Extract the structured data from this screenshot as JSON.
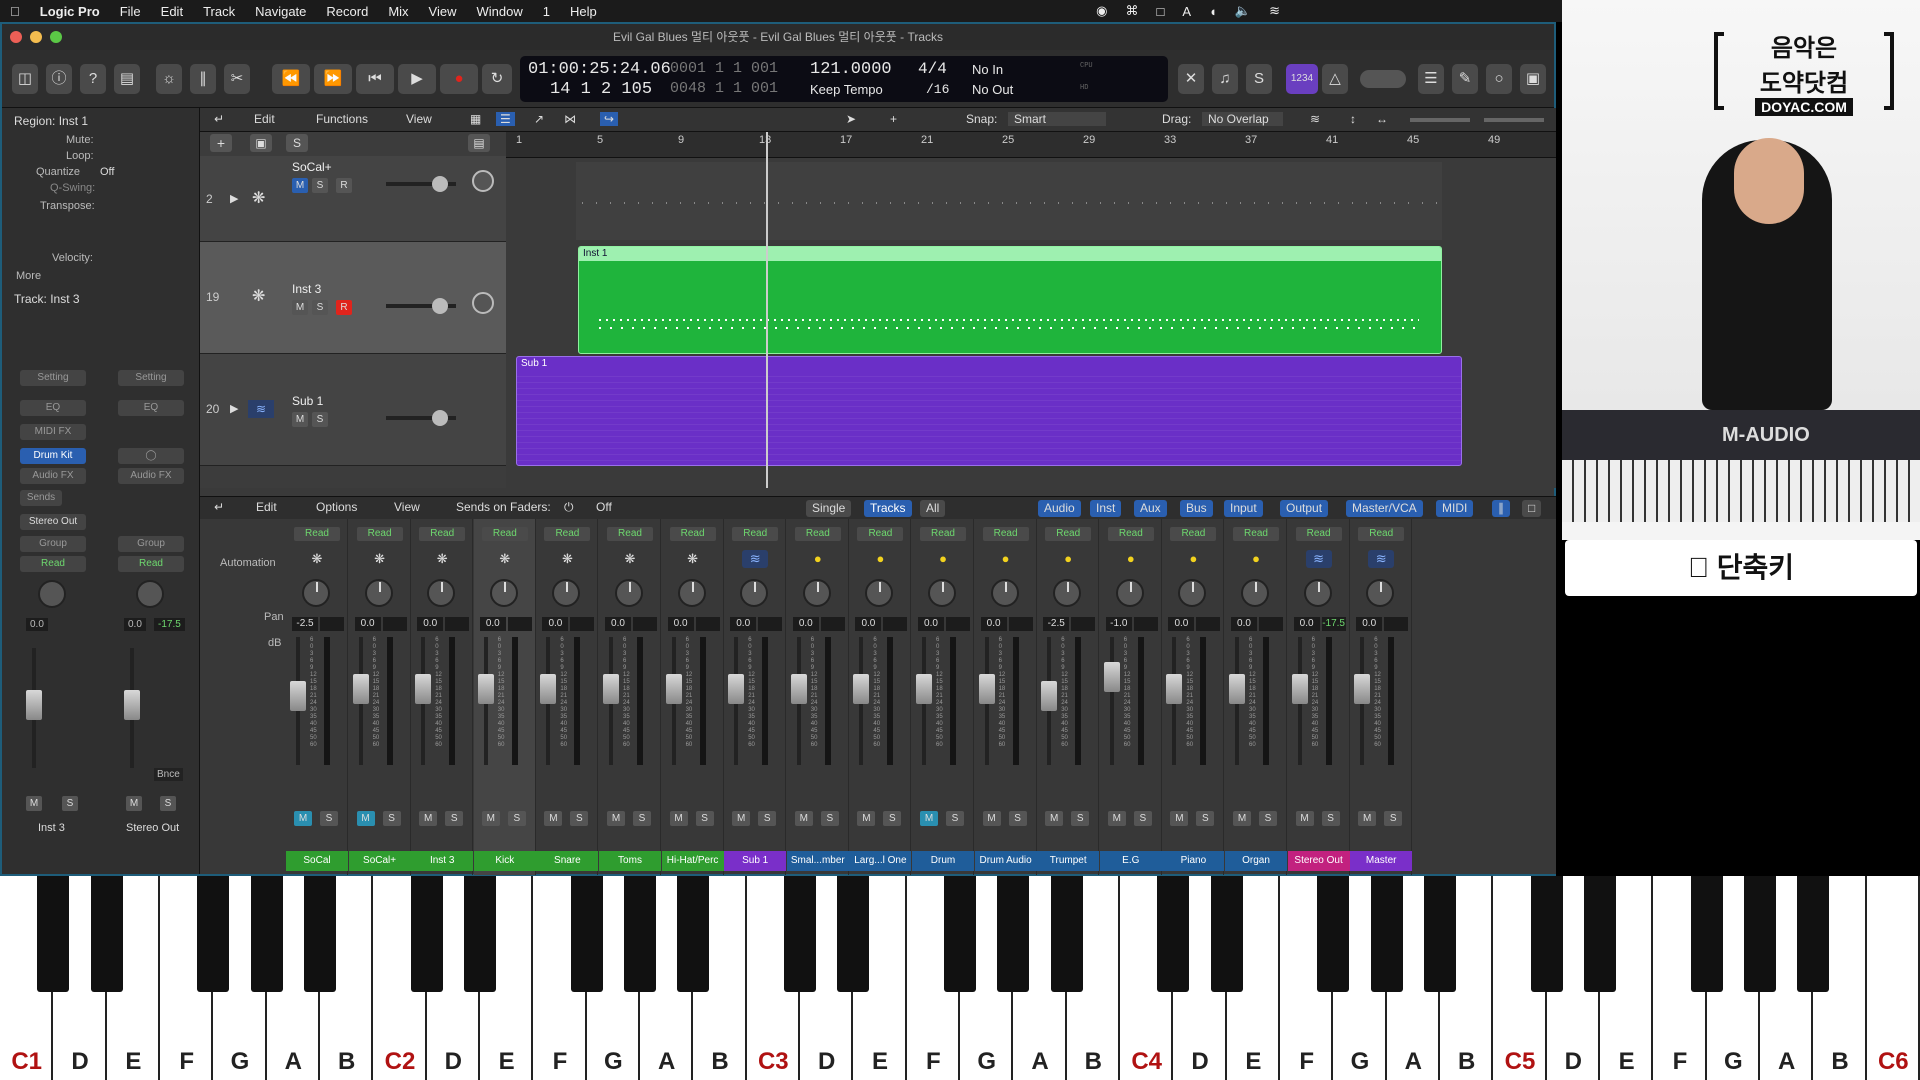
{
  "menubar": {
    "app": "Logic Pro",
    "items": [
      "File",
      "Edit",
      "Track",
      "Navigate",
      "Record",
      "Mix",
      "View",
      "Window",
      "1",
      "Help"
    ]
  },
  "window_title": "Evil Gal Blues 멀티 아웃풋 - Evil Gal Blues 멀티 아웃풋 - Tracks",
  "lcd": {
    "position_time": "01:00:25:24.06",
    "bars1": "0001  1  1  001",
    "tempo": "121.0000",
    "signature": "4/4",
    "in": "No In",
    "position_bars": "14  1  2  105",
    "bars2": "0048  1  1  001",
    "tempo_mode": "Keep Tempo",
    "division": "/16",
    "out": "No Out",
    "cpu": "CPU",
    "hd": "HD"
  },
  "inspector": {
    "region_header": "Region: Inst 1",
    "mute": "Mute:",
    "loop": "Loop:",
    "quantize_label": "Quantize",
    "quantize_value": "Off",
    "qswing": "Q-Swing:",
    "transpose": "Transpose:",
    "velocity": "Velocity:",
    "more": "More",
    "track_header": "Track:  Inst 3",
    "setting": "Setting",
    "eq": "EQ",
    "midi_fx": "MIDI FX",
    "drum_kit": "Drum Kit",
    "audio_fx": "Audio FX",
    "sends": "Sends",
    "stereo_out": "Stereo Out",
    "group": "Group",
    "read": "Read",
    "db_left": "0.0",
    "db_right": "0.0",
    "db_right2": "-17.5",
    "bnce": "Bnce",
    "strip1_name": "Inst 3",
    "strip2_name": "Stereo Out"
  },
  "tm_toolbar": {
    "edit": "Edit",
    "functions": "Functions",
    "view": "View",
    "snap_label": "Snap:",
    "snap_value": "Smart",
    "drag_label": "Drag:",
    "drag_value": "No Overlap"
  },
  "ruler": [
    "1",
    "5",
    "9",
    "13",
    "17",
    "21",
    "25",
    "29",
    "33",
    "37",
    "41",
    "45",
    "49"
  ],
  "tracks": [
    {
      "num": "2",
      "name": "SoCal+"
    },
    {
      "num": "19",
      "name": "Inst 3"
    },
    {
      "num": "20",
      "name": "Sub 1"
    }
  ],
  "regions": {
    "inst": "Inst 1",
    "sub": "Sub 1"
  },
  "mixer_toolbar": {
    "edit": "Edit",
    "options": "Options",
    "view": "View",
    "sends_label": "Sends on Faders:",
    "sends_value": "Off",
    "single": "Single",
    "tracks": "Tracks",
    "all": "All",
    "filters": [
      "Audio",
      "Inst",
      "Aux",
      "Bus",
      "Input",
      "Output",
      "Master/VCA",
      "MIDI"
    ]
  },
  "mixer_labels": {
    "automation": "Automation",
    "pan": "Pan",
    "db": "dB"
  },
  "channels": [
    {
      "name": "SoCal",
      "db": "-2.5",
      "level": 0.55,
      "color": "#2f9d2f",
      "icon": "drum-kit-icon",
      "mute_on": true
    },
    {
      "name": "SoCal+",
      "db": "0.0",
      "level": 0.62,
      "color": "#2f9d2f",
      "icon": "drum-kit-icon",
      "mute_on": true
    },
    {
      "name": "Inst 3",
      "db": "0.0",
      "level": 0.62,
      "color": "#2f9d2f",
      "icon": "drum-kit-icon",
      "mute_on": false
    },
    {
      "name": "Kick",
      "db": "0.0",
      "level": 0.62,
      "color": "#2f9d2f",
      "icon": "drum-kit-icon",
      "mute_on": false
    },
    {
      "name": "Snare",
      "db": "0.0",
      "level": 0.62,
      "color": "#2f9d2f",
      "icon": "drum-kit-icon",
      "mute_on": false
    },
    {
      "name": "Toms",
      "db": "0.0",
      "level": 0.62,
      "color": "#2f9d2f",
      "icon": "drum-kit-icon",
      "mute_on": false
    },
    {
      "name": "Hi-Hat/Perc",
      "db": "0.0",
      "level": 0.62,
      "color": "#2f9d2f",
      "icon": "drum-kit-icon",
      "mute_on": false
    },
    {
      "name": "Sub 1",
      "db": "0.0",
      "level": 0.62,
      "color": "#7a2fc9",
      "icon": "waveform-icon",
      "mute_on": false
    },
    {
      "name": "Smal...mber",
      "db": "0.0",
      "level": 0.62,
      "color": "#1f5d9a",
      "icon": "knob-icon",
      "mute_on": false
    },
    {
      "name": "Larg...l One",
      "db": "0.0",
      "level": 0.62,
      "color": "#1f5d9a",
      "icon": "knob-icon",
      "mute_on": false
    },
    {
      "name": "Drum",
      "db": "0.0",
      "level": 0.62,
      "color": "#1f5d9a",
      "icon": "knob-icon",
      "mute_on": true
    },
    {
      "name": "Drum Audio",
      "db": "0.0",
      "level": 0.62,
      "color": "#1f5d9a",
      "icon": "knob-icon",
      "mute_on": false
    },
    {
      "name": "Trumpet",
      "db": "-2.5",
      "level": 0.55,
      "color": "#1f5d9a",
      "icon": "knob-icon",
      "mute_on": false
    },
    {
      "name": "E.G",
      "db": "-1.0",
      "level": 0.74,
      "color": "#1f5d9a",
      "icon": "knob-icon",
      "mute_on": false
    },
    {
      "name": "Piano",
      "db": "0.0",
      "level": 0.62,
      "color": "#1f5d9a",
      "icon": "knob-icon",
      "mute_on": false
    },
    {
      "name": "Organ",
      "db": "0.0",
      "level": 0.62,
      "color": "#1f5d9a",
      "icon": "knob-icon",
      "mute_on": false
    },
    {
      "name": "Stereo Out",
      "db": "0.0",
      "db2": "-17.5",
      "level": 0.62,
      "color": "#c2217f",
      "icon": "waveform-icon",
      "mute_on": false
    },
    {
      "name": "Master",
      "db": "0.0",
      "level": 0.62,
      "color": "#7a2fc9",
      "icon": "waveform-icon",
      "mute_on": false
    }
  ],
  "brand": {
    "line1": "음악은",
    "line2": "도약닷컴",
    "domain": "DOYAC.COM"
  },
  "keyboard_brand": "M-AUDIO",
  "shortcut_label": "단축키",
  "piano_keys": [
    "C1",
    "D",
    "E",
    "F",
    "G",
    "A",
    "B",
    "C2",
    "D",
    "E",
    "F",
    "G",
    "A",
    "B",
    "C3",
    "D",
    "E",
    "F",
    "G",
    "A",
    "B",
    "C4",
    "D",
    "E",
    "F",
    "G",
    "A",
    "B",
    "C5",
    "D",
    "E",
    "F",
    "G",
    "A",
    "B",
    "C6"
  ],
  "colors": {
    "accent_blue": "#2a5fb0",
    "region_green": "#1fb43c",
    "region_purple": "#6a2fc7",
    "record_red": "#e0241c"
  }
}
